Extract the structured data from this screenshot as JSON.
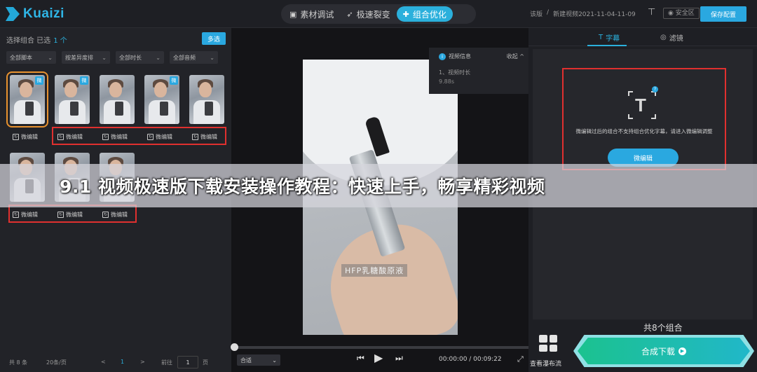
{
  "app": {
    "name": "Kuaizi",
    "brand_color": "#2bb0dc"
  },
  "modes": [
    {
      "label": "素材调试",
      "icon": "film-icon"
    },
    {
      "label": "极速裂变",
      "icon": "rocket-icon"
    },
    {
      "label": "组合优化",
      "icon": "combine-icon",
      "active": true
    }
  ],
  "header": {
    "crumb_1": "该版",
    "crumb_sep": "/",
    "crumb_2": "新建视频2021-11-04-11-09",
    "safe_zone": "安全区",
    "save_config": "保存配置"
  },
  "left": {
    "select_label": "选择组合 已选",
    "select_count": "1 个",
    "multi_select": "多选",
    "filters": [
      "全部脚本",
      "按差异度排",
      "全部时长",
      "全部音频"
    ],
    "micro_edit": "微编辑",
    "badge": "微",
    "footer": {
      "total": "共 8 条",
      "per_page": "20条/页",
      "prev": "<",
      "page": "1",
      "next": ">",
      "goto": "前往",
      "goto_value": "1",
      "page_unit": "页"
    }
  },
  "player": {
    "info_title": "视频信息",
    "info_collapse": "收起 ^",
    "info_row1": "1、视频时长",
    "info_row2": "9.88s",
    "subtitle": "HFP乳糖酸原液",
    "fit": "合适",
    "time": "00:00:00 / 00:09:22"
  },
  "right": {
    "tab_subtitle": "字幕",
    "tab_filter": "滤镜",
    "notice": "微编辑过后的组合不支持组合优化字幕，请进入微编辑调整",
    "micro_edit_btn": "微编辑",
    "combos": "共8个组合",
    "flow": "查看瀑布流",
    "download": "合成下载"
  },
  "banner": {
    "text": "9.1 视频极速版下载安装操作教程：快速上手，畅享精彩视频"
  }
}
